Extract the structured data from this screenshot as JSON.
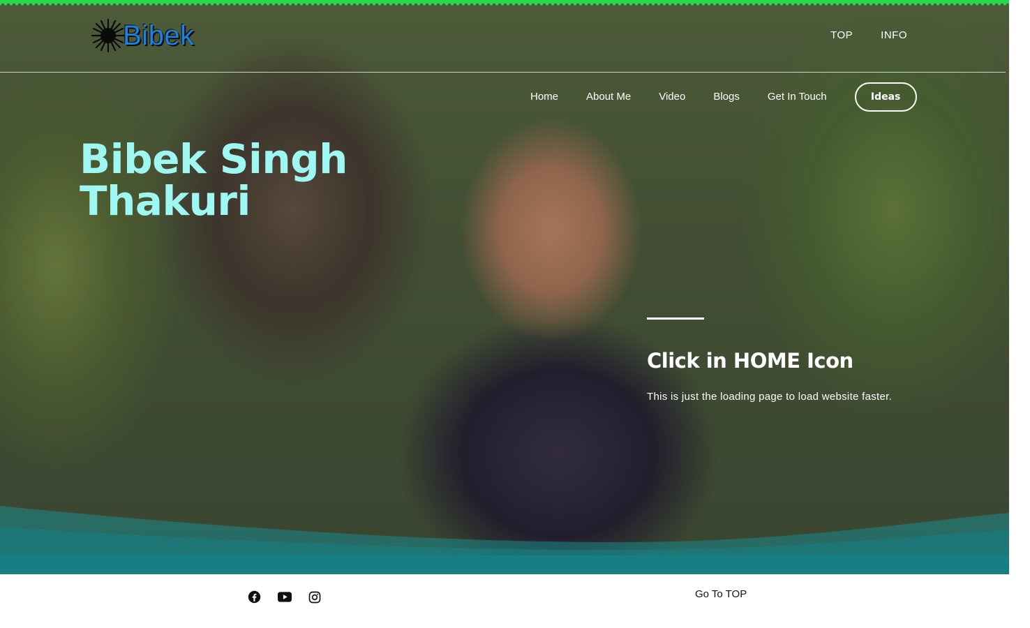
{
  "header": {
    "logo_text": "Bibek",
    "top_links": [
      "TOP",
      "INFO"
    ]
  },
  "nav": {
    "items": [
      "Home",
      "About Me",
      "Video",
      "Blogs",
      "Get In Touch"
    ],
    "cta": "Ideas"
  },
  "hero": {
    "title_line1": "Bibek Singh",
    "title_line2": "Thakuri",
    "heading": "Click in HOME Icon",
    "text": "This is just the loading page to load website faster."
  },
  "footer": {
    "social_icons": [
      "facebook-icon",
      "youtube-icon",
      "instagram-icon"
    ],
    "go_top": "Go To TOP"
  },
  "colors": {
    "title": "#9ef7f1",
    "zigzag": "#27d84f",
    "teal": "#177f84",
    "logo": "#1a82e0"
  }
}
